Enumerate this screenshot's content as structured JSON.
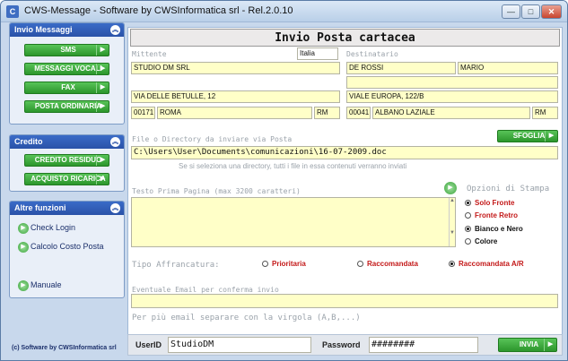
{
  "window": {
    "title": "CWS-Message - Software by CWSInformatica srl - Rel.2.0.10",
    "app_icon": "C",
    "minimize": "—",
    "maximize": "□",
    "close": "✕"
  },
  "sidebar": {
    "invio": {
      "title": "Invio Messaggi",
      "buttons": [
        "SMS",
        "MESSAGGI VOCALI",
        "FAX",
        "POSTA ORDINARIA"
      ]
    },
    "credito": {
      "title": "Credito",
      "buttons": [
        "CREDITO RESIDUO",
        "ACQUISTO RICARICA"
      ]
    },
    "altre": {
      "title": "Altre funzioni",
      "links": [
        "Check Login",
        "Calcolo Costo Posta",
        "Manuale"
      ]
    },
    "credits": "(c) Software by CWSInformatica srl"
  },
  "form": {
    "title": "Invio Posta cartacea",
    "mittente_label": "Mittente",
    "destinatario_label": "Destinatario",
    "mittente": {
      "country": "Italia",
      "name": "STUDIO DM SRL",
      "line2": "",
      "address": "VIA DELLE BETULLE, 12",
      "cap": "00171",
      "city": "ROMA",
      "prov": "RM"
    },
    "destinatario": {
      "surname": "DE ROSSI",
      "name": "MARIO",
      "line2": "",
      "address": "VIALE EUROPA, 122/B",
      "cap": "00041",
      "city": "ALBANO LAZIALE",
      "prov": "RM"
    },
    "file_label": "File o Directory da inviare via Posta",
    "file_path": "C:\\Users\\User\\Documents\\comunicazioni\\16-07-2009.doc",
    "sfoglia": "SFOGLIA",
    "dir_note": "Se si seleziona una directory, tutti i file in essa contenuti verranno inviati",
    "testo_label": "Testo Prima Pagina (max 3200 caratteri)",
    "opzioni_label": "Opzioni di Stampa",
    "opzioni": [
      "Solo Fronte",
      "Fronte Retro",
      "Bianco e Nero",
      "Colore"
    ],
    "affrancatura_label": "Tipo Affrancatura:",
    "affrancatura": [
      "Prioritaria",
      "Raccomandata",
      "Raccomandata A/R"
    ],
    "email_label": "Eventuale Email per conferma invio",
    "email_note": "Per più email separare con la virgola (A,B,...)"
  },
  "login": {
    "userid_label": "UserID",
    "userid": "StudioDM",
    "password_label": "Password",
    "password": "########",
    "invia": "INVIA"
  }
}
